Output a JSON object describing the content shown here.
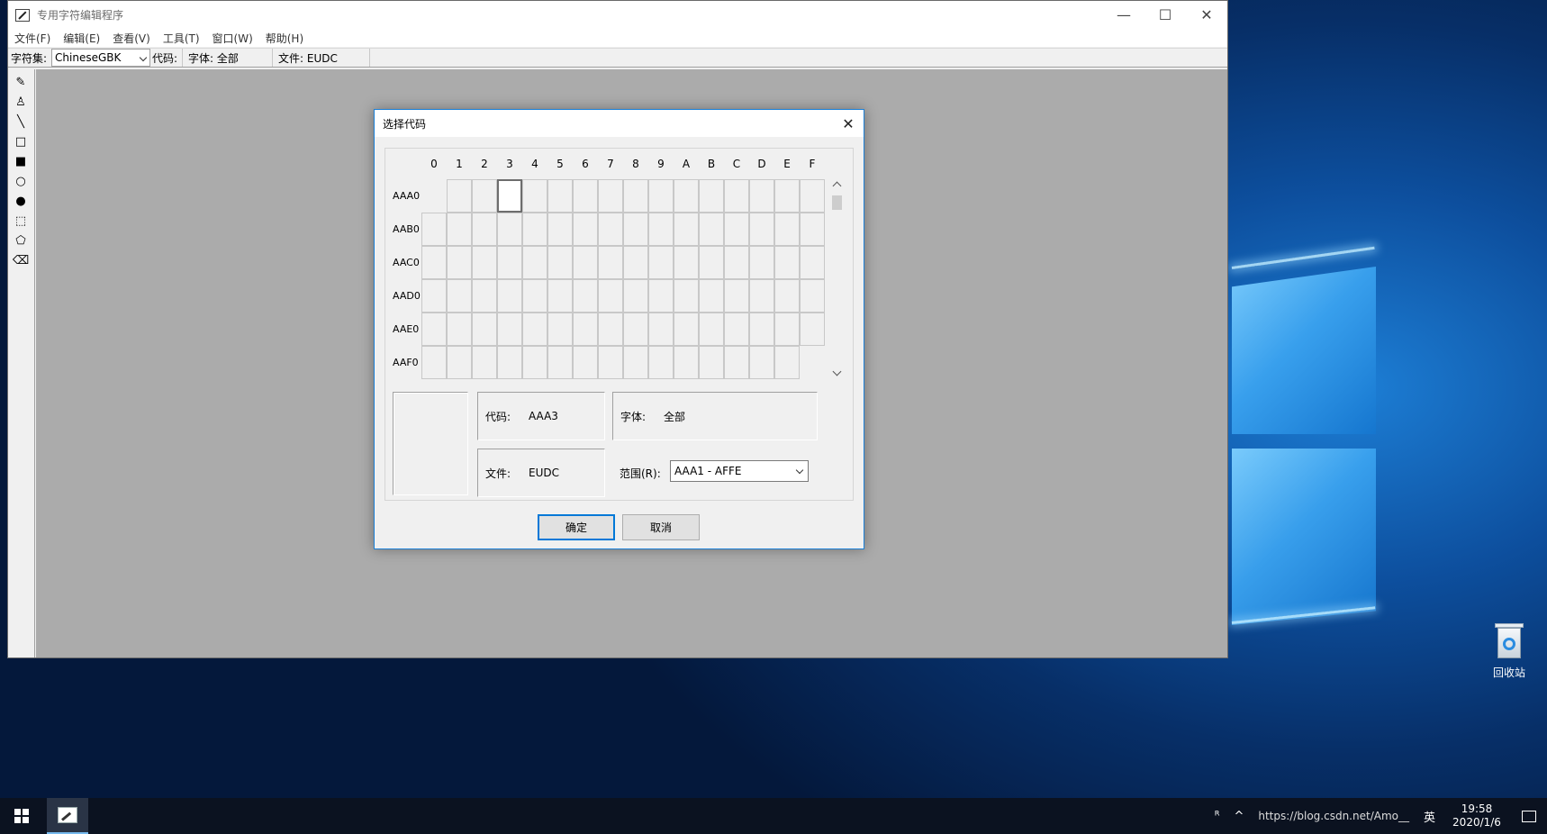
{
  "window": {
    "title": "专用字符编辑程序",
    "controls": {
      "minimize": "—",
      "maximize": "☐",
      "close": "✕"
    }
  },
  "menu": [
    {
      "label": "文件(F)"
    },
    {
      "label": "编辑(E)"
    },
    {
      "label": "查看(V)"
    },
    {
      "label": "工具(T)"
    },
    {
      "label": "窗口(W)"
    },
    {
      "label": "帮助(H)"
    }
  ],
  "toolbar": {
    "charset_label": "字符集:",
    "charset_value": "ChineseGBK",
    "code_label": "代码:",
    "font_text": "字体: 全部",
    "file_text": "文件: EUDC"
  },
  "tools": [
    {
      "icon": "pencil-icon",
      "glyph": "✎"
    },
    {
      "icon": "brush-icon",
      "glyph": "♙"
    },
    {
      "icon": "line-icon",
      "glyph": "╲"
    },
    {
      "icon": "rectangle-outline-icon",
      "glyph": "□"
    },
    {
      "icon": "rectangle-filled-icon",
      "glyph": "■"
    },
    {
      "icon": "ellipse-outline-icon",
      "glyph": "○"
    },
    {
      "icon": "ellipse-filled-icon",
      "glyph": "●"
    },
    {
      "icon": "rect-select-icon",
      "glyph": "⬚"
    },
    {
      "icon": "freeform-select-icon",
      "glyph": "⬠"
    },
    {
      "icon": "eraser-icon",
      "glyph": "⌫"
    }
  ],
  "dialog": {
    "title": "选择代码",
    "close": "✕",
    "columns": [
      "0",
      "1",
      "2",
      "3",
      "4",
      "5",
      "6",
      "7",
      "8",
      "9",
      "A",
      "B",
      "C",
      "D",
      "E",
      "F"
    ],
    "rows": [
      "AAA0",
      "AAB0",
      "AAC0",
      "AAD0",
      "AAE0",
      "AAF0"
    ],
    "selected_code": "AAA3",
    "code_label": "代码:",
    "code_value": "AAA3",
    "font_label": "字体:",
    "font_value": "全部",
    "file_label": "文件:",
    "file_value": "EUDC",
    "range_label": "范围(R):",
    "range_value": "AAA1 - AFFE",
    "ok_label": "确定",
    "cancel_label": "取消"
  },
  "desktop": {
    "recycle_bin_label": "回收站"
  },
  "taskbar": {
    "tray_people": "ᴿ",
    "tray_chevron": "^",
    "tray_text": "https://blog.csdn.net/Amo__",
    "ime": "英",
    "time": "19:58",
    "date": "2020/1/6"
  },
  "colors": {
    "accent": "#0078d7",
    "canvas": "#ababab",
    "taskbar": "#0b1220"
  }
}
